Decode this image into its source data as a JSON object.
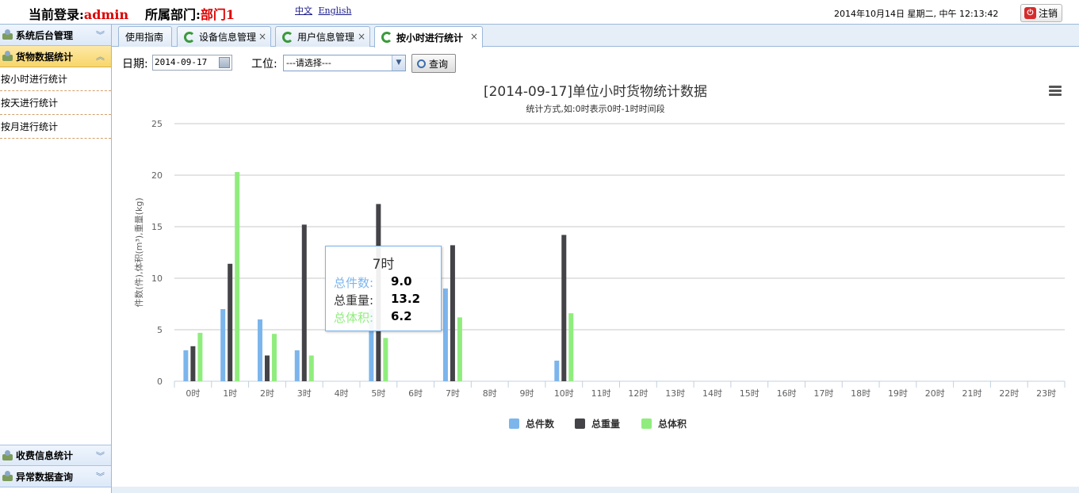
{
  "header": {
    "login_label": "当前登录:",
    "login_user": "admin",
    "dept_label": "所属部门:",
    "dept_value": "部门1",
    "lang_cn": "中文",
    "lang_en": "English",
    "datetime": "2014年10月14日 星期二, 中午 12:13:42",
    "logout_label": "注销"
  },
  "sidebar": {
    "sections": [
      {
        "label": "系统后台管理",
        "icon": "package-icon",
        "state": "collapsed"
      },
      {
        "label": "货物数据统计",
        "icon": "package-icon",
        "state": "expanded"
      },
      {
        "label": "收费信息统计",
        "icon": "package-icon",
        "state": "collapsed"
      },
      {
        "label": "异常数据查询",
        "icon": "package-icon",
        "state": "collapsed"
      }
    ],
    "items": [
      {
        "label": "按小时进行统计"
      },
      {
        "label": "按天进行统计"
      },
      {
        "label": "按月进行统计"
      }
    ]
  },
  "tabs": [
    {
      "label": "使用指南",
      "closable": false
    },
    {
      "label": "设备信息管理",
      "closable": true
    },
    {
      "label": "用户信息管理",
      "closable": true
    },
    {
      "label": "按小时进行统计",
      "closable": true,
      "active": true
    }
  ],
  "query": {
    "date_label": "日期:",
    "date_value": "2014-09-17",
    "station_label": "工位:",
    "station_value": "---请选择---",
    "query_button": "查询"
  },
  "tooltip": {
    "title": "7时",
    "rows": [
      {
        "label": "总件数:",
        "value": "9.0",
        "color": "#7cb5ec"
      },
      {
        "label": "总重量:",
        "value": "13.2",
        "color": "#434348"
      },
      {
        "label": "总体积:",
        "value": "6.2",
        "color": "#90ed7d"
      }
    ]
  },
  "chart_data": {
    "type": "bar",
    "title": "[2014-09-17]单位小时货物统计数据",
    "subtitle": "统计方式,如:0时表示0时-1时时间段",
    "ylabel": "件数(件),体积(m³),重量(kg)",
    "ylim": [
      0,
      25
    ],
    "yticks": [
      "0",
      "5",
      "10",
      "15",
      "20",
      "25"
    ],
    "categories": [
      "0时",
      "1时",
      "2时",
      "3时",
      "4时",
      "5时",
      "6时",
      "7时",
      "8时",
      "9时",
      "10时",
      "11时",
      "12时",
      "13时",
      "14时",
      "15时",
      "16时",
      "17时",
      "18时",
      "19时",
      "20时",
      "21时",
      "22时",
      "23时"
    ],
    "series": [
      {
        "name": "总件数",
        "color": "#7cb5ec",
        "values": [
          3,
          7,
          6,
          3,
          0,
          7,
          0,
          9,
          0,
          0,
          2,
          0,
          0,
          0,
          0,
          0,
          0,
          0,
          0,
          0,
          0,
          0,
          0,
          0
        ]
      },
      {
        "name": "总重量",
        "color": "#434348",
        "values": [
          3.4,
          11.4,
          2.5,
          15.2,
          0,
          17.2,
          0,
          13.2,
          0,
          0,
          14.2,
          0,
          0,
          0,
          0,
          0,
          0,
          0,
          0,
          0,
          0,
          0,
          0,
          0
        ]
      },
      {
        "name": "总体积",
        "color": "#90ed7d",
        "values": [
          4.7,
          20.3,
          4.6,
          2.5,
          0,
          4.2,
          0,
          6.2,
          0,
          0,
          6.6,
          0,
          0,
          0,
          0,
          0,
          0,
          0,
          0,
          0,
          0,
          0,
          0,
          0
        ]
      }
    ],
    "grid": true,
    "legend": "bottom-center"
  }
}
